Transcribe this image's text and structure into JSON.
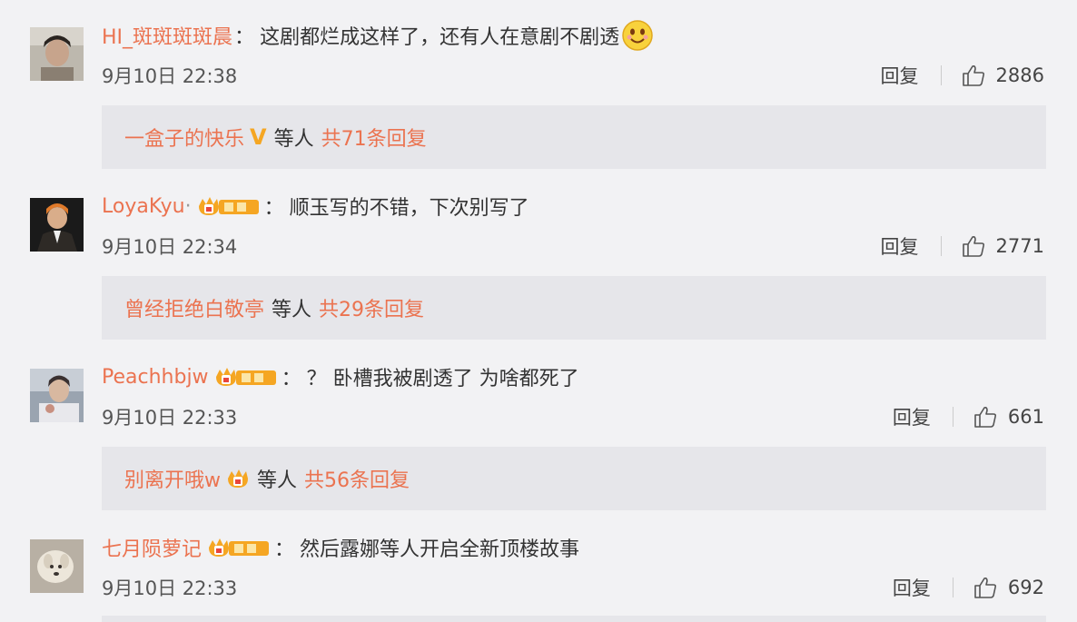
{
  "comments": [
    {
      "username": "HI_斑斑斑斑晨",
      "colon": "：",
      "text": "这剧都烂成这样了，还有人在意剧不剧透",
      "time": "9月10日 22:38",
      "reply_label": "回复",
      "likes": "2886",
      "sub": {
        "name": "一盒子的快乐",
        "v": "V",
        "etc": "等人",
        "total": "共71条回复"
      }
    },
    {
      "username": "LoyaKyu",
      "dot": "·",
      "colon": "：",
      "text": "顺玉写的不错，下次别写了",
      "time": "9月10日 22:34",
      "reply_label": "回复",
      "likes": "2771",
      "sub": {
        "name": "曾经拒绝白敬亭",
        "etc": "等人",
        "total": "共29条回复"
      }
    },
    {
      "username": "Peachhbjw",
      "colon": "：",
      "text": "？ 卧槽我被剧透了 为啥都死了",
      "time": "9月10日 22:33",
      "reply_label": "回复",
      "likes": "661",
      "sub": {
        "name": "别离开哦w",
        "etc": "等人",
        "total": "共56条回复"
      }
    },
    {
      "username": "七月陨萝记",
      "colon": "：",
      "text": "然后露娜等人开启全新顶楼故事",
      "time": "9月10日 22:33",
      "reply_label": "回复",
      "likes": "692"
    }
  ],
  "colors": {
    "accent": "#eb7350",
    "badge_gold": "#f5a623",
    "badge_red": "#e8463c"
  },
  "icons": {
    "like": "thumbs-up-icon",
    "emoji": "smile-emoji-icon",
    "badge": "crown-badge-icon"
  }
}
